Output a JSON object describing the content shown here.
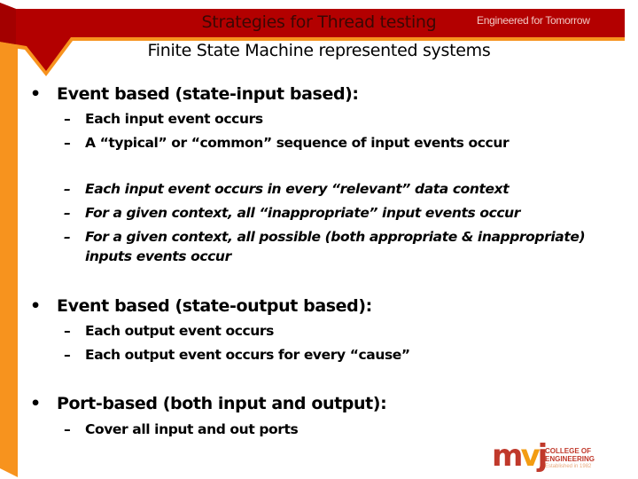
{
  "header": {
    "title": "Strategies for Thread testing",
    "tagline": "Engineered for Tomorrow",
    "subtitle": "Finite State Machine represented systems",
    "colors": {
      "band": "#b30000",
      "accent": "#f7931e",
      "title_text": "#3a0804"
    }
  },
  "content": {
    "bullets": [
      {
        "label": "Event based (state-input based):",
        "groups": [
          {
            "style": "normal",
            "items": [
              "Each input event occurs",
              "A “typical” or “common” sequence of input events occur"
            ]
          },
          {
            "style": "italic",
            "items": [
              "Each input event occurs in every “relevant” data context",
              "For a given context, all “inappropriate” input events occur",
              "For a given context, all possible (both appropriate & inappropriate)",
              "inputs events occur"
            ]
          }
        ]
      },
      {
        "label": "Event based (state-output based):",
        "groups": [
          {
            "style": "normal",
            "items": [
              "Each output event occurs",
              "Each output event occurs for every “cause”"
            ]
          }
        ]
      },
      {
        "label": "Port-based (both input and output):",
        "groups": [
          {
            "style": "normal",
            "items": [
              "Cover all input and out ports"
            ]
          }
        ]
      }
    ],
    "bullet_glyph": "•",
    "dash_glyph": "–"
  },
  "logo": {
    "letters": {
      "m": "m",
      "v": "v",
      "j": "j"
    },
    "line1": "COLLEGE OF",
    "line2": "ENGINEERING",
    "line3": "Established in 1982"
  }
}
